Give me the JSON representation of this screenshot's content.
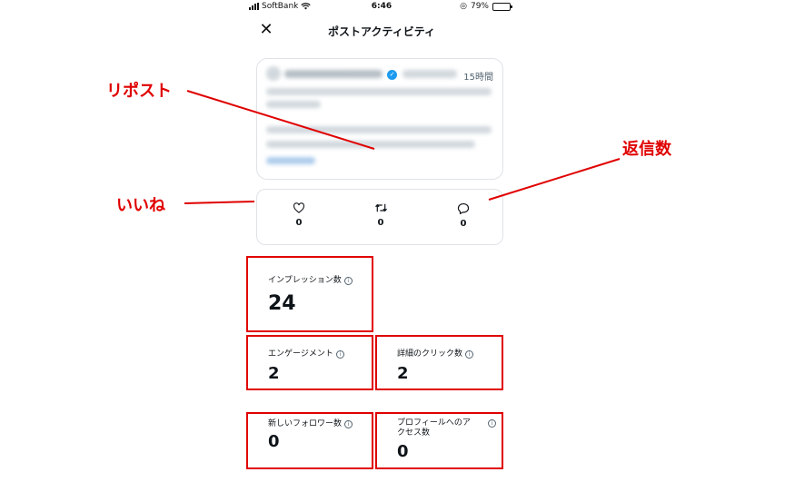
{
  "status_bar": {
    "carrier": "SoftBank",
    "time": "6:46",
    "battery_percent": "79%",
    "battery_level": 0.79
  },
  "header": {
    "close_icon": "close-x-icon",
    "title": "ポストアクティビティ"
  },
  "post": {
    "time_ago": "15時間"
  },
  "engagement": {
    "likes": "0",
    "reposts": "0",
    "replies": "0"
  },
  "stats": {
    "impressions": {
      "label": "インプレッション数",
      "value": "24"
    },
    "engagements": {
      "label": "エンゲージメント",
      "value": "2"
    },
    "detail_clicks": {
      "label": "詳細のクリック数",
      "value": "2"
    },
    "new_followers": {
      "label": "新しいフォロワー数",
      "value": "0"
    },
    "profile_visits": {
      "label_line1": "プロフィールへのア",
      "label_line2": "クセス数",
      "value": "0"
    }
  },
  "annotations": {
    "repost": "リポスト",
    "like": "いいね",
    "reply": "返信数",
    "color": "#e00000"
  }
}
